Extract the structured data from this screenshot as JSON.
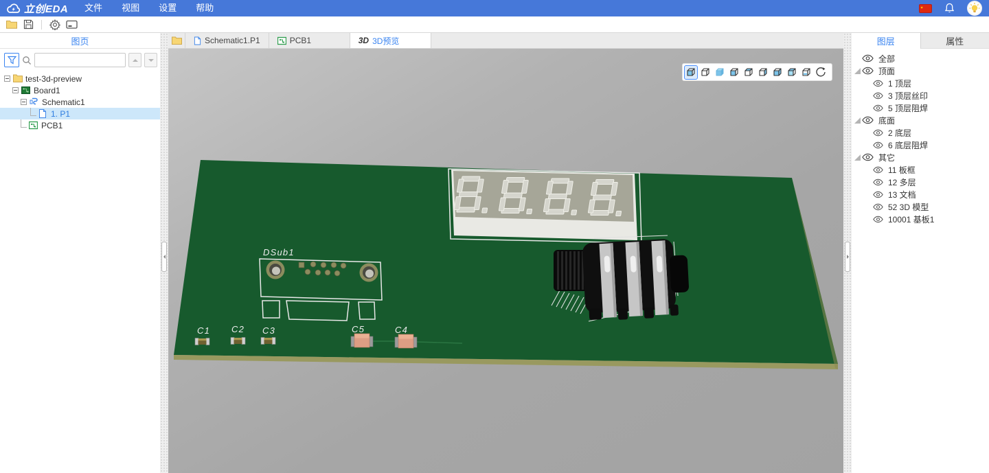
{
  "topbar": {
    "logo": "立创EDA",
    "menus": [
      {
        "label": "文件"
      },
      {
        "label": "视图"
      },
      {
        "label": "设置"
      },
      {
        "label": "帮助"
      }
    ]
  },
  "quick_toolbar": {
    "icons": [
      "folder-open",
      "save",
      "settings",
      "device-manager"
    ]
  },
  "left_panel": {
    "title": "图页",
    "search": {
      "placeholder": "",
      "value": ""
    },
    "tree": [
      {
        "label": "test-3d-preview",
        "type": "folder",
        "level": 0,
        "expanded": true
      },
      {
        "label": "Board1",
        "type": "board",
        "level": 1,
        "expanded": true
      },
      {
        "label": "Schematic1",
        "type": "schematic",
        "level": 2,
        "expanded": true
      },
      {
        "label": "1. P1",
        "type": "page",
        "level": 3,
        "selected": true
      },
      {
        "label": "PCB1",
        "type": "pcb",
        "level": 2
      }
    ]
  },
  "doc_tabs": {
    "tabs": [
      {
        "label": "Schematic1.P1",
        "icon": "page",
        "active": false
      },
      {
        "label": "PCB1",
        "icon": "pcb",
        "active": false
      },
      {
        "label": "3D预览",
        "icon": "3D",
        "prefix": "3D",
        "active": true
      }
    ]
  },
  "viewport": {
    "view_buttons": [
      "isometric-view",
      "wireframe-view",
      "solid-view",
      "front-view",
      "back-view",
      "left-view",
      "right-view",
      "top-view",
      "bottom-view",
      "rotate-view"
    ],
    "active_view": "isometric-view"
  },
  "board": {
    "display_digits": "8.8.8.8.",
    "refdes": {
      "dsub": "DSub1",
      "c1": "C1",
      "c2": "C2",
      "c3": "C3",
      "c5": "C5",
      "c4": "C4"
    }
  },
  "right_panel": {
    "tabs": [
      {
        "label": "图层",
        "active": true
      },
      {
        "label": "属性",
        "active": false
      }
    ],
    "layers": [
      {
        "label": "全部",
        "level": 0,
        "expander": false
      },
      {
        "label": "顶面",
        "level": 0,
        "expander": true
      },
      {
        "label": "1 顶层",
        "level": 1
      },
      {
        "label": "3 顶层丝印",
        "level": 1
      },
      {
        "label": "5 顶层阻焊",
        "level": 1
      },
      {
        "label": "底面",
        "level": 0,
        "expander": true
      },
      {
        "label": "2 底层",
        "level": 1
      },
      {
        "label": "6 底层阻焊",
        "level": 1
      },
      {
        "label": "其它",
        "level": 0,
        "expander": true
      },
      {
        "label": "11 板框",
        "level": 1
      },
      {
        "label": "12 多层",
        "level": 1
      },
      {
        "label": "13 文档",
        "level": 1
      },
      {
        "label": "52 3D 模型",
        "level": 1
      },
      {
        "label": "10001 基板1",
        "level": 1
      }
    ]
  },
  "colors": {
    "accent": "#3a84f0",
    "topbar": "#4678d9",
    "board_green": "#175a2d",
    "board_edge": "#99995f",
    "copper_pad": "#8c8c5e",
    "display_face": "#a6a698",
    "display_segment": "#d5d5cd",
    "cap_small": "#6f6130",
    "cap_large": "#dd9e84",
    "viewport_bg": "#ababab"
  }
}
